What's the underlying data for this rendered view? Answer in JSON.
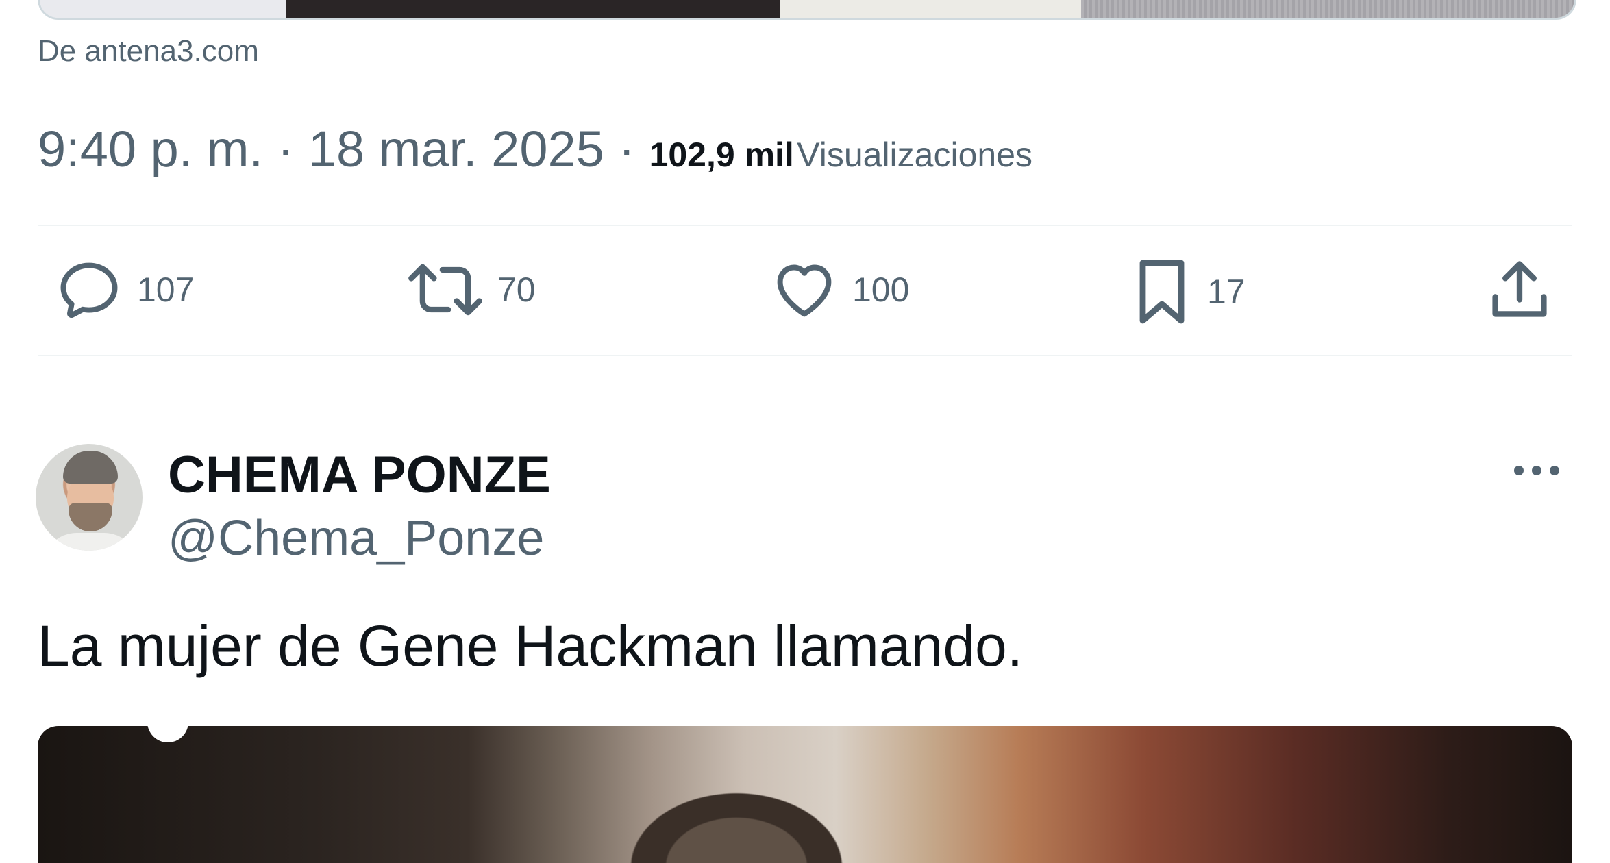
{
  "previous_tweet": {
    "link_source": "De antena3.com",
    "timestamp": "9:40 p. m. · 18 mar. 2025",
    "views_count": "102,9 mil",
    "views_label": "Visualizaciones",
    "actions": {
      "reply": {
        "icon": "reply-icon",
        "count": "107"
      },
      "retweet": {
        "icon": "retweet-icon",
        "count": "70"
      },
      "like": {
        "icon": "heart-icon",
        "count": "100"
      },
      "bookmark": {
        "icon": "bookmark-icon",
        "count": "17"
      },
      "share": {
        "icon": "share-icon"
      }
    }
  },
  "tweet": {
    "display_name": "CHEMA PONZE",
    "handle": "@Chema_Ponze",
    "text": "La mujer de Gene Hackman llamando.",
    "more_icon": "more-options-icon"
  },
  "colors": {
    "primary_text": "#0f1419",
    "secondary_text": "#536471",
    "divider": "#eff3f4"
  }
}
